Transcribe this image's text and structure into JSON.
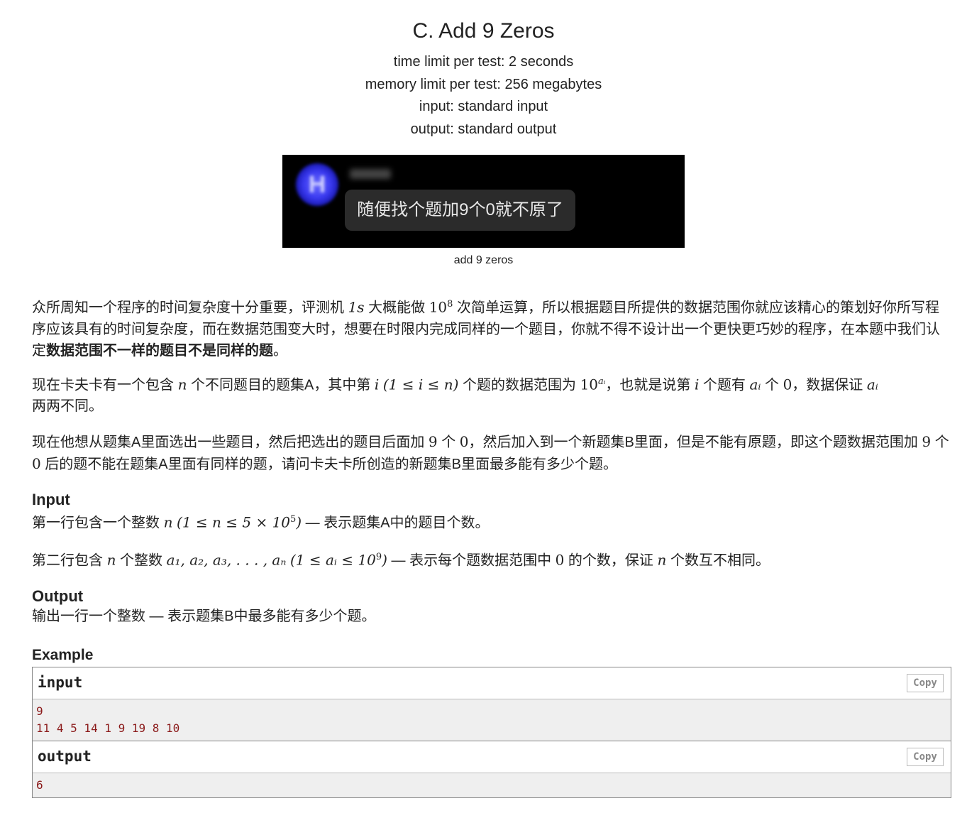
{
  "problem": {
    "title": "C. Add 9 Zeros",
    "time_limit": "time limit per test: 2 seconds",
    "memory_limit": "memory limit per test: 256 megabytes",
    "input_type": "input: standard input",
    "output_type": "output: standard output"
  },
  "figure": {
    "avatar_letter": "H",
    "bubble_text": "随便找个题加9个0就不原了",
    "caption": "add 9 zeros"
  },
  "statement": {
    "p1_a": "众所周知一个程序的时间复杂度十分重要，评测机 ",
    "p1_math1": "1s",
    "p1_b": " 大概能做 ",
    "p1_math2_base": "10",
    "p1_math2_sup": "8",
    "p1_c": " 次简单运算，所以根据题目所提供的数据范围你就应该精心的策划好你所写程序应该具有的时间复杂度，而在数据范围变大时，想要在时限内完成同样的一个题目，你就不得不设计出一个更快更巧妙的程序，在本题中我们认定",
    "p1_bold": "数据范围不一样的题目不是同样的题",
    "p1_end": "。",
    "p2_a": "现在卡夫卡有一个包含 ",
    "p2_n": "n",
    "p2_b": " 个不同题目的题集A，其中第 ",
    "p2_i": "i",
    "p2_range": "(1 ≤ i ≤ n)",
    "p2_c": " 个题的数据范围为 ",
    "p2_pow_base": "10",
    "p2_pow_sup": "aᵢ",
    "p2_d": "，也就是说第 ",
    "p2_e": " 个题有 ",
    "p2_ai": "aᵢ",
    "p2_f": " 个 ",
    "p2_zero": "0",
    "p2_g": "，数据保证 ",
    "p2_h": "两两不同。",
    "p3_a": "现在他想从题集A里面选出一些题目，然后把选出的题目后面加 ",
    "p3_nine": "9",
    "p3_b": " 个 ",
    "p3_zero": "0",
    "p3_c": "，然后加入到一个新题集B里面，但是不能有原题，即这个题数据范围加 ",
    "p3_d": " 个 ",
    "p3_e": " 后的题不能在题集A里面有同样的题，请问卡夫卡所创造的新题集B里面最多能有多少个题。"
  },
  "input_section": {
    "title": "Input",
    "l1_a": "第一行包含一个整数 ",
    "l1_n": "n",
    "l1_range_a": "(1 ≤ n ≤ 5 × 10",
    "l1_range_sup": "5",
    "l1_range_b": ")",
    "l1_b": " — 表示题集A中的题目个数。",
    "l2_a": "第二行包含 ",
    "l2_n": "n",
    "l2_b": " 个整数 ",
    "l2_seq": "a₁, a₂, a₃, . . . , aₙ",
    "l2_range_a": "(1 ≤ aᵢ ≤ 10",
    "l2_range_sup": "9",
    "l2_range_b": ")",
    "l2_c": " — 表示每个题数据范围中 ",
    "l2_zero": "0",
    "l2_d": " 的个数，保证 ",
    "l2_e": " 个数互不相同。"
  },
  "output_section": {
    "title": "Output",
    "text": "输出一行一个整数 — 表示题集B中最多能有多少个题。"
  },
  "example": {
    "title": "Example",
    "input_label": "input",
    "output_label": "output",
    "copy_label": "Copy",
    "input_lines": [
      "9",
      "11 4 5 14 1 9 19 8 10"
    ],
    "output_lines": [
      "6"
    ]
  }
}
